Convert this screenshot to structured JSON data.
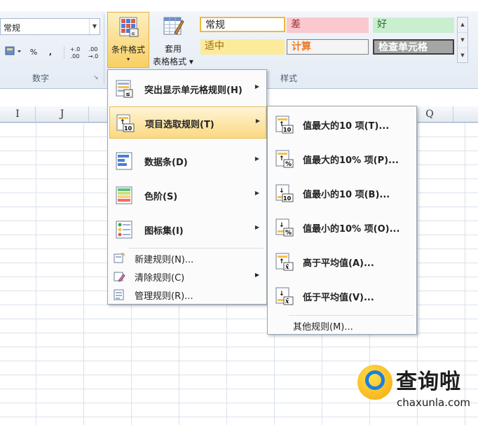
{
  "ribbon": {
    "number_format_value": "常规",
    "number_group_label": "数字",
    "styles_group_label": "样式",
    "small_buttons": [
      "%",
      ",",
      "+.0 .00",
      ".00 →.0"
    ],
    "conditional_format": {
      "label": "条件格式",
      "arrow": "▾"
    },
    "format_as_table": {
      "line1": "套用",
      "line2": "表格格式 ▾"
    },
    "cell_styles": [
      {
        "label": "常规",
        "bg": "#ffffff",
        "border": "#f0b93a",
        "color": "#222222"
      },
      {
        "label": "差",
        "bg": "#fac8ce",
        "border": "#fac8ce",
        "color": "#9c2b35"
      },
      {
        "label": "好",
        "bg": "#c9efcf",
        "border": "#c9efcf",
        "color": "#2d6e36"
      },
      {
        "label": "适中",
        "bg": "#fdeb9c",
        "border": "#fdeb9c",
        "color": "#9a6b12"
      },
      {
        "label": "计算",
        "bg": "#f4f4f4",
        "border": "#7f7f7f",
        "color": "#f37720"
      },
      {
        "label": "检查单元格",
        "bg": "#a5a5a5",
        "border": "#3f3f3f",
        "color": "#ffffff"
      }
    ]
  },
  "columns": [
    "I",
    "J",
    "Q"
  ],
  "main_menu": {
    "items": [
      {
        "label": "突出显示单元格规则(H)",
        "icon": "highlight-rules-icon"
      },
      {
        "label": "项目选取规则(T)",
        "icon": "top-bottom-rules-icon"
      },
      {
        "label": "数据条(D)",
        "icon": "data-bars-icon"
      },
      {
        "label": "色阶(S)",
        "icon": "color-scales-icon"
      },
      {
        "label": "图标集(I)",
        "icon": "icon-sets-icon"
      }
    ],
    "small_items": [
      {
        "label": "新建规则(N)...",
        "icon": "new-rule-icon"
      },
      {
        "label": "清除规则(C)",
        "icon": "clear-rules-icon"
      },
      {
        "label": "管理规则(R)...",
        "icon": "manage-rules-icon"
      }
    ]
  },
  "submenu": {
    "items": [
      {
        "label": "值最大的10 项(T)...",
        "badge": "10"
      },
      {
        "label": "值最大的10% 项(P)...",
        "badge": "%"
      },
      {
        "label": "值最小的10 项(B)...",
        "badge": "10"
      },
      {
        "label": "值最小的10% 项(O)...",
        "badge": "%"
      },
      {
        "label": "高于平均值(A)...",
        "badge": "x̄"
      },
      {
        "label": "低于平均值(V)...",
        "badge": "x̄"
      }
    ],
    "more_rules": "其他规则(M)..."
  },
  "watermark": {
    "name": "查询啦",
    "url": "chaxunla.com"
  }
}
